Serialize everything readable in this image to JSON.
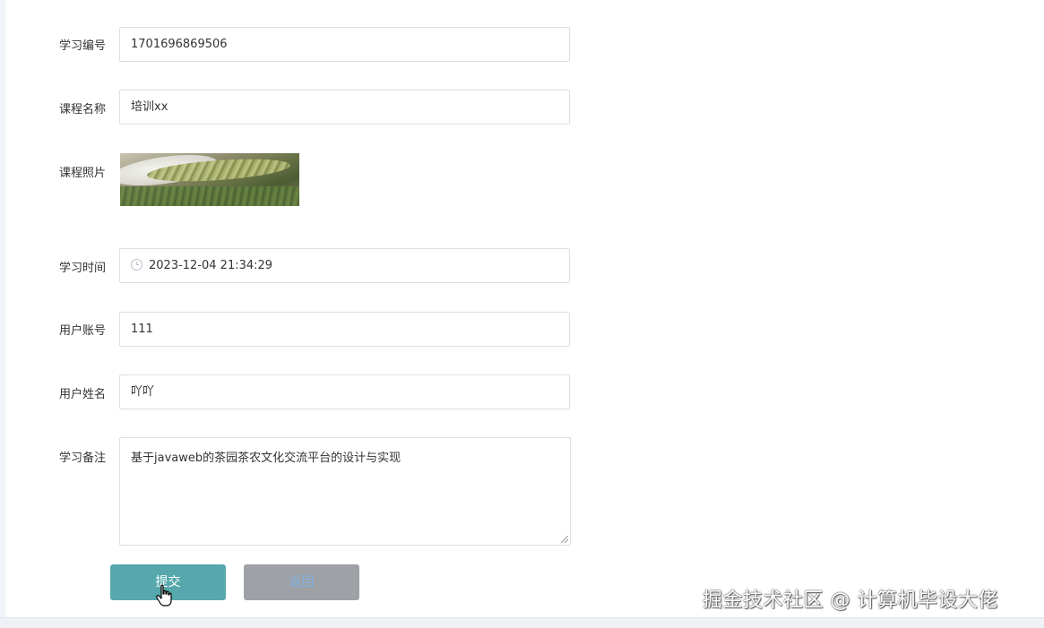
{
  "form": {
    "fields": {
      "study_id": {
        "label": "学习编号",
        "value": "1701696869506"
      },
      "course_name": {
        "label": "课程名称",
        "value": "培训xx"
      },
      "course_photo": {
        "label": "课程照片"
      },
      "study_time": {
        "label": "学习时间",
        "value": "2023-12-04 21:34:29"
      },
      "user_account": {
        "label": "用户账号",
        "value": "111"
      },
      "user_name": {
        "label": "用户姓名",
        "value": "吖吖"
      },
      "study_note": {
        "label": "学习备注",
        "value": "基于javaweb的茶园茶农文化交流平台的设计与实现"
      }
    },
    "buttons": {
      "submit_label": "提交",
      "back_label": "返回"
    }
  },
  "watermark": "掘金技术社区 @ 计算机毕设大佬",
  "colors": {
    "submit_bg": "#56a8ac",
    "back_bg": "#9ea1a5",
    "border": "#dcdfe6"
  },
  "icons": {
    "time_prefix": "clock-icon",
    "cursor": "hand-pointer-icon"
  }
}
